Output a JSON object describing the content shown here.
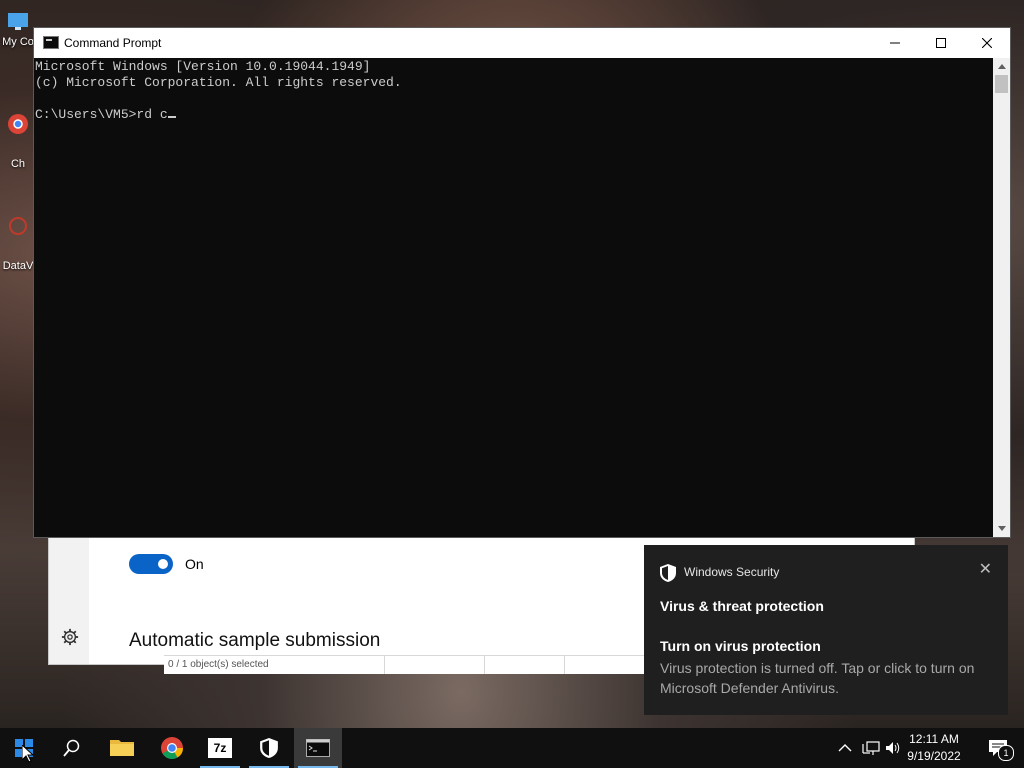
{
  "desktop": {
    "icons": [
      {
        "label": "My Co"
      },
      {
        "label": "Ch"
      },
      {
        "label": "DataV"
      }
    ]
  },
  "cmd": {
    "title": "Command Prompt",
    "lines": [
      "Microsoft Windows [Version 10.0.19044.1949]",
      "(c) Microsoft Corporation. All rights reserved.",
      "",
      "C:\\Users\\VM5>rd c"
    ],
    "minimize_glyph": "—",
    "maximize_glyph": "☐",
    "close_glyph": "✕"
  },
  "settings": {
    "toggle_label": "On",
    "section_heading": "Automatic sample submission"
  },
  "explorer": {
    "status": "0 / 1 object(s) selected"
  },
  "toast": {
    "app_name": "Windows Security",
    "heading": "Virus & threat protection",
    "subheading": "Turn on virus protection",
    "body": "Virus protection is turned off. Tap or click to turn on Microsoft Defender Antivirus.",
    "close_glyph": "✕"
  },
  "taskbar": {
    "items": [
      {
        "name": "start",
        "icon": "windows-logo-icon"
      },
      {
        "name": "search",
        "icon": "search-icon"
      },
      {
        "name": "file-explorer",
        "icon": "folder-icon"
      },
      {
        "name": "chrome",
        "icon": "chrome-icon"
      },
      {
        "name": "7zip",
        "icon": "7zip-icon",
        "label": "7z"
      },
      {
        "name": "windows-security",
        "icon": "shield-icon"
      },
      {
        "name": "command-prompt",
        "icon": "terminal-icon"
      }
    ],
    "time": "12:11 AM",
    "date": "9/19/2022",
    "notification_count": "1"
  },
  "colors": {
    "accent": "#0a64c8",
    "console_bg": "#0c0c0c",
    "console_fg": "#cccccc",
    "toast_bg": "#1f1f1f",
    "taskbar_bg": "#101010"
  }
}
